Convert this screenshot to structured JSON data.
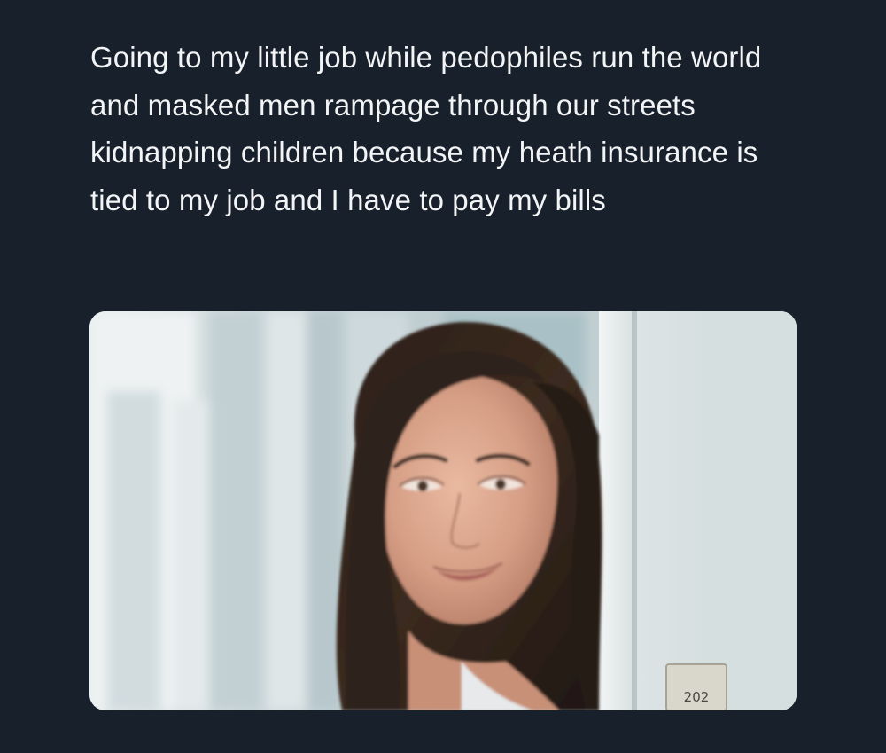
{
  "post": {
    "text": "Going to my little job while pedophiles run the world and masked men rampage through our streets kidnapping children because my heath insurance is tied to my job and I have to pay my bills"
  },
  "media": {
    "door_number": "202"
  },
  "colors": {
    "background": "#18202c",
    "text": "#f2f4f6"
  }
}
